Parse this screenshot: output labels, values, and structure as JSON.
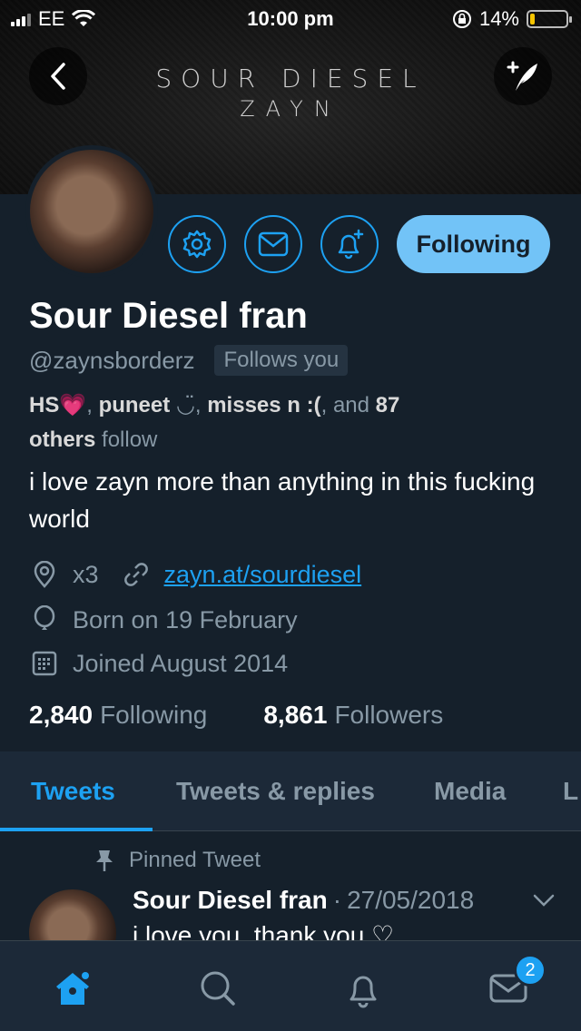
{
  "status_bar": {
    "carrier": "EE",
    "time": "10:00 pm",
    "battery_percent": "14%",
    "battery_level": 0.14
  },
  "banner": {
    "line1": "SOUR DIESEL",
    "line2": "ZAYN"
  },
  "profile": {
    "name": "Sour Diesel fran",
    "handle": "@zaynsborderz",
    "follows_you": "Follows you",
    "follow_button": "Following",
    "mutuals": {
      "user1": "HS",
      "emoji1": "💗",
      "user2": "puneet",
      "emoji2": "◡̈",
      "user3": "misses n :(",
      "and_text": ", and",
      "others_count": "87",
      "others_label": "others",
      "follow_text": "follow"
    },
    "bio": "i love zayn more than anything in this fucking world",
    "location": "x3",
    "website": "zayn.at/sourdiesel",
    "birthday": "Born on 19 February",
    "joined": "Joined August 2014",
    "following_count": "2,840",
    "following_label": "Following",
    "followers_count": "8,861",
    "followers_label": "Followers"
  },
  "tabs": [
    "Tweets",
    "Tweets & replies",
    "Media",
    "L"
  ],
  "pinned_tweet": {
    "label": "Pinned Tweet",
    "author": "Sour Diesel fran",
    "separator": "·",
    "date": "27/05/2018",
    "text": "i love you, thank you ♡"
  },
  "bottom_bar": {
    "message_badge": "2"
  },
  "colors": {
    "background": "#15202b",
    "accent": "#1da1f2",
    "follow_button": "#72c3f7",
    "secondary_text": "#8899a6"
  }
}
